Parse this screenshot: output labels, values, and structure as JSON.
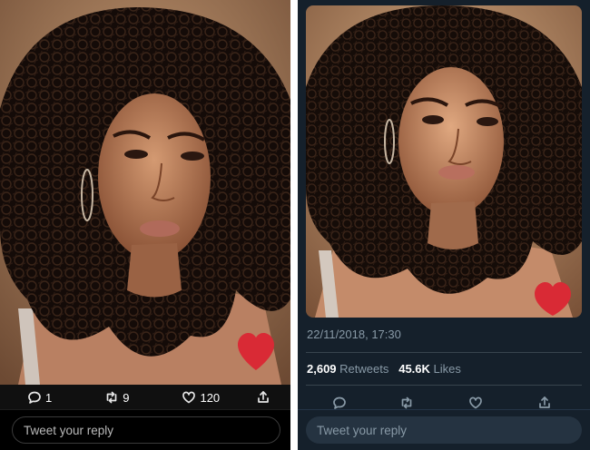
{
  "left_panel": {
    "theme": "light-dark",
    "actions": {
      "reply_icon": "reply-bubble-icon",
      "reply_count": "1",
      "retweet_icon": "retweet-icon",
      "retweet_count": "9",
      "like_icon": "heart-outline-icon",
      "like_count": "120",
      "share_icon": "share-icon"
    },
    "reply_placeholder": "Tweet your reply"
  },
  "right_panel": {
    "theme": "dim",
    "timestamp": "22/11/2018, 17:30",
    "retweets_count": "2,609",
    "retweets_label": "Retweets",
    "likes_count": "45.6K",
    "likes_label": "Likes",
    "reply_placeholder": "Tweet your reply"
  },
  "colors": {
    "dim_background": "#15202b",
    "muted_text": "#8899a6",
    "heart_red": "#d92a35"
  }
}
